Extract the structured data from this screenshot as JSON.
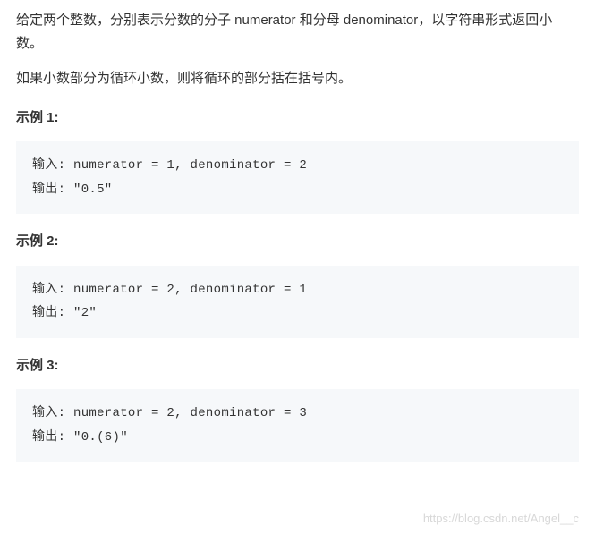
{
  "description_line1": "给定两个整数，分别表示分数的分子 numerator 和分母 denominator，以字符串形式返回小数。",
  "description_line2": "如果小数部分为循环小数，则将循环的部分括在括号内。",
  "examples": [
    {
      "title": "示例 1:",
      "content": "输入: numerator = 1, denominator = 2\n输出: \"0.5\""
    },
    {
      "title": "示例 2:",
      "content": "输入: numerator = 2, denominator = 1\n输出: \"2\""
    },
    {
      "title": "示例 3:",
      "content": "输入: numerator = 2, denominator = 3\n输出: \"0.(6)\""
    }
  ],
  "watermark": "https://blog.csdn.net/Angel__c"
}
